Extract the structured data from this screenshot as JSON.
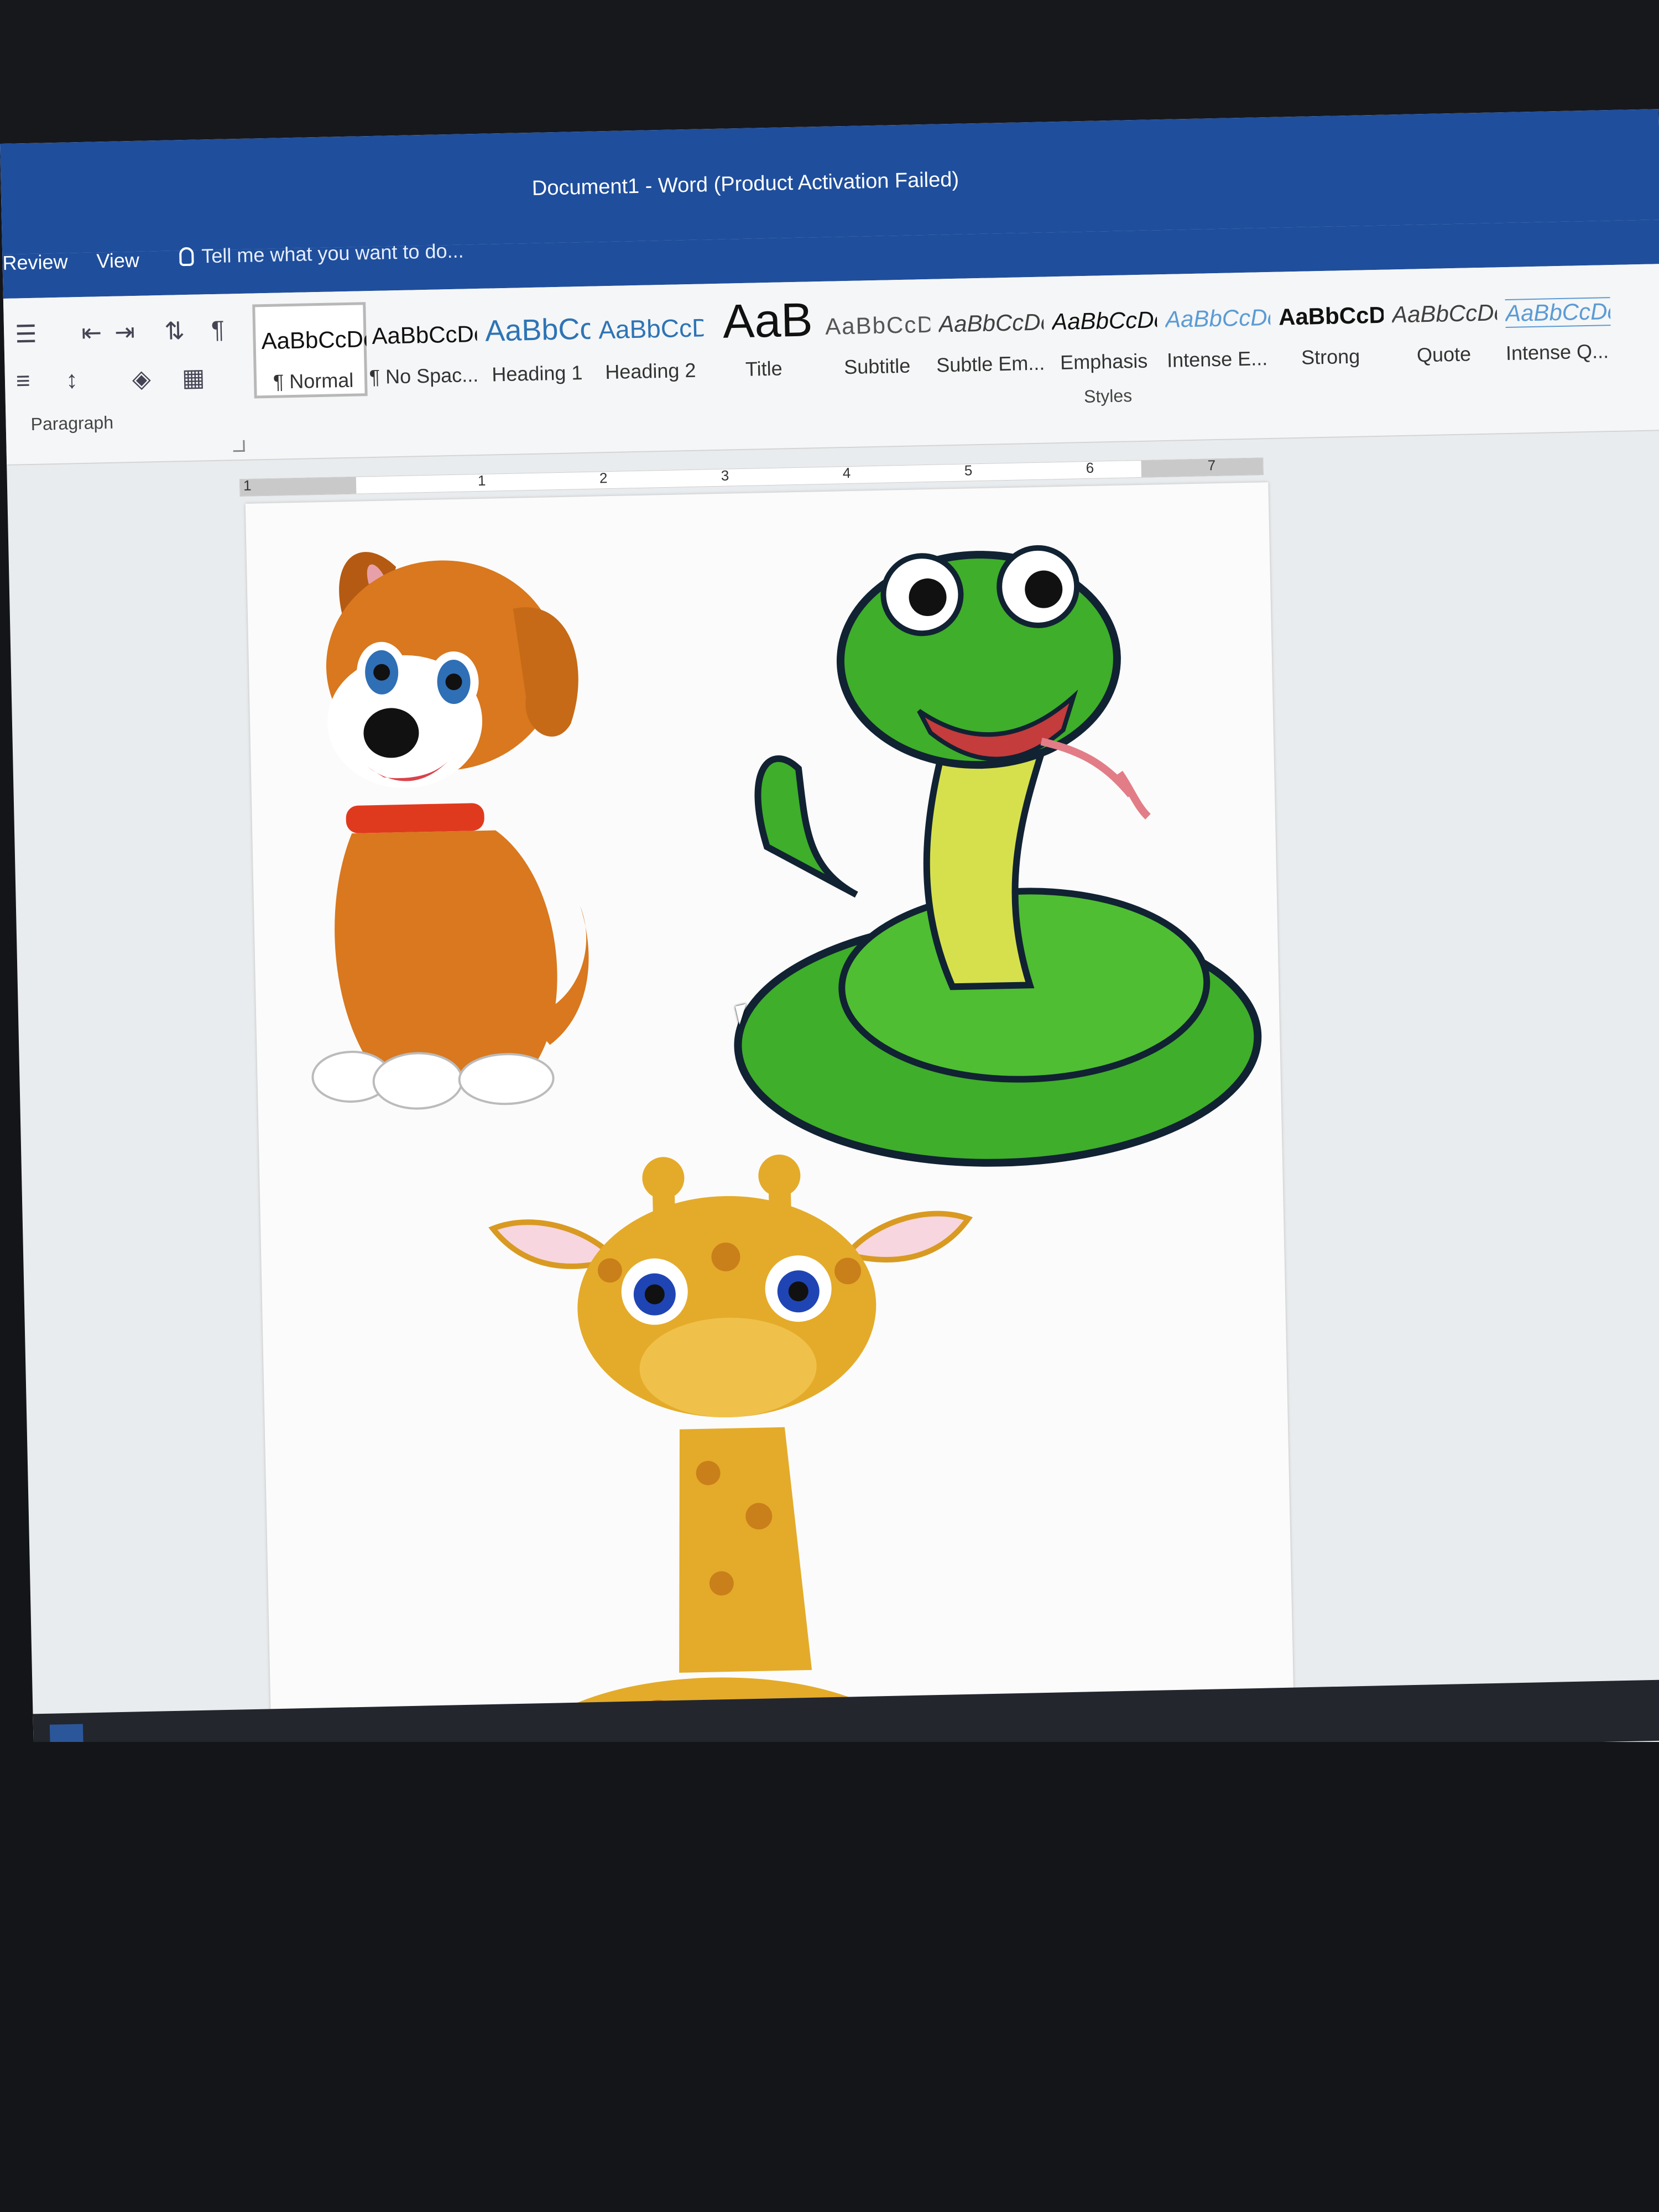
{
  "window": {
    "title": "Document1 - Word (Product Activation Failed)"
  },
  "tabs": [
    {
      "label": "Review"
    },
    {
      "label": "View"
    }
  ],
  "tell_me": {
    "placeholder": "Tell me what you want to do..."
  },
  "paragraph_group": {
    "label": "Paragraph"
  },
  "styles_group": {
    "label": "Styles",
    "items": [
      {
        "sample": "AaBbCcDc",
        "name": "¶ Normal",
        "selected": true
      },
      {
        "sample": "AaBbCcDc",
        "name": "¶ No Spac..."
      },
      {
        "sample": "AaBbCc",
        "name": "Heading 1"
      },
      {
        "sample": "AaBbCcD",
        "name": "Heading 2"
      },
      {
        "sample": "AaB",
        "name": "Title"
      },
      {
        "sample": "AaBbCcD",
        "name": "Subtitle"
      },
      {
        "sample": "AaBbCcDc",
        "name": "Subtle Em..."
      },
      {
        "sample": "AaBbCcDc",
        "name": "Emphasis"
      },
      {
        "sample": "AaBbCcDc",
        "name": "Intense E..."
      },
      {
        "sample": "AaBbCcDc",
        "name": "Strong"
      },
      {
        "sample": "AaBbCcDc",
        "name": "Quote"
      },
      {
        "sample": "AaBbCcDc",
        "name": "Intense Q..."
      }
    ]
  },
  "ruler": {
    "marks": [
      "1",
      "1",
      "2",
      "3",
      "4",
      "5",
      "6",
      "7"
    ]
  },
  "document": {
    "images": [
      {
        "name": "cartoon-puppy"
      },
      {
        "name": "cartoon-snake"
      },
      {
        "name": "cartoon-giraffe"
      }
    ]
  },
  "colors": {
    "titlebar": "#1f4e9c",
    "ribbon": "#f5f6f7",
    "dog": "#d9781e",
    "snake": "#3fae2a",
    "giraffe": "#e4ab2a"
  }
}
